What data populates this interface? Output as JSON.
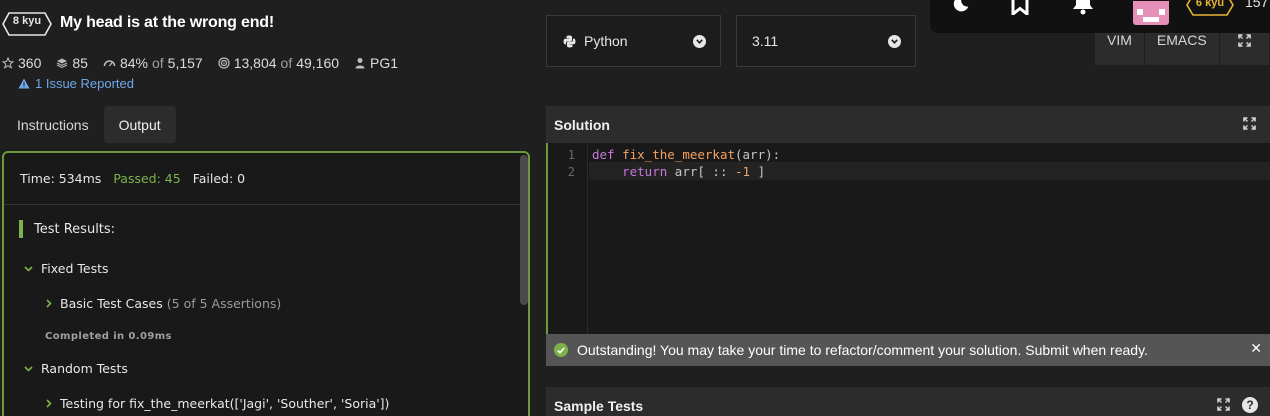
{
  "kata": {
    "rank": "8 kyu",
    "title": "My head is at the wrong end!",
    "stats": {
      "stars": "360",
      "collections": "85",
      "satisfaction": "84%",
      "satisfaction_of_label": "of",
      "satisfaction_votes": "5,157",
      "completed": "13,804",
      "completed_of_label": "of",
      "attempted": "49,160",
      "author": "PG1"
    },
    "issues": "1 Issue Reported"
  },
  "tabs": [
    "Instructions",
    "Output"
  ],
  "active_tab": "Output",
  "output": {
    "time": "Time: 534ms",
    "passed": "Passed: 45",
    "failed": "Failed: 0",
    "results_heading": "Test Results:",
    "fixed_tests": "Fixed Tests",
    "basic_test_cases": "Basic Test Cases",
    "basic_assertions": "(5 of 5 Assertions)",
    "completed_in": "Completed in 0.09ms",
    "random_tests": "Random Tests",
    "random_case": "Testing for fix_the_meerkat(['Jagi', 'Souther', 'Soria'])"
  },
  "language": {
    "selected": "Python",
    "version": "3.11"
  },
  "editor_modes": [
    "VIM",
    "EMACS"
  ],
  "top_nav": {
    "user_rank": "6 kyu",
    "honor": "157"
  },
  "solution": {
    "heading": "Solution",
    "line_numbers": [
      "1",
      "2"
    ],
    "code": {
      "l1_kw": "def",
      "l1_fn": "fix_the_meerkat",
      "l1_rest": "(arr):",
      "l2_indent": "    ",
      "l2_kw": "return",
      "l2_a": " arr[ :: ",
      "l2_num": "-1",
      "l2_b": " ]"
    }
  },
  "notice": "Outstanding! You may take your time to refactor/comment your solution. Submit when ready.",
  "sample_tests": {
    "heading": "Sample Tests"
  },
  "colors": {
    "success": "#7cb24b",
    "link": "#6ea7ec",
    "rank_yellow": "#e7b434",
    "panel_border": "#6a9a3a"
  }
}
